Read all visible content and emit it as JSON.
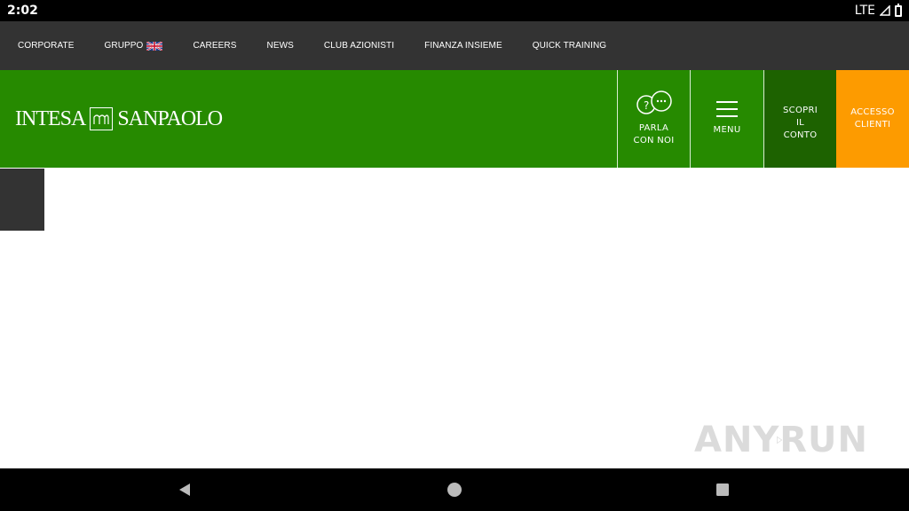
{
  "status": {
    "time": "2:02",
    "network": "LTE"
  },
  "top_nav": {
    "items": [
      {
        "label": "CORPORATE"
      },
      {
        "label": "GRUPPO",
        "icon": "uk-flag-icon"
      },
      {
        "label": "CAREERS"
      },
      {
        "label": "NEWS"
      },
      {
        "label": "CLUB AZIONISTI"
      },
      {
        "label": "FINANZA INSIEME"
      },
      {
        "label": "QUICK TRAINING"
      }
    ]
  },
  "header": {
    "logo": {
      "left": "INTESA",
      "right": "SANPAOLO"
    },
    "buttons": {
      "parla": "PARLA\nCON NOI",
      "menu": "MENU",
      "scopri": "SCOPRI\nIL\nCONTO",
      "accesso": "ACCESSO\nCLIENTI"
    }
  },
  "watermark": {
    "left": "ANY",
    "right": "RUN"
  },
  "colors": {
    "header_green": "#268a00",
    "dark_green": "#1d6200",
    "orange": "#fd9b00",
    "top_nav_bg": "#333333"
  }
}
